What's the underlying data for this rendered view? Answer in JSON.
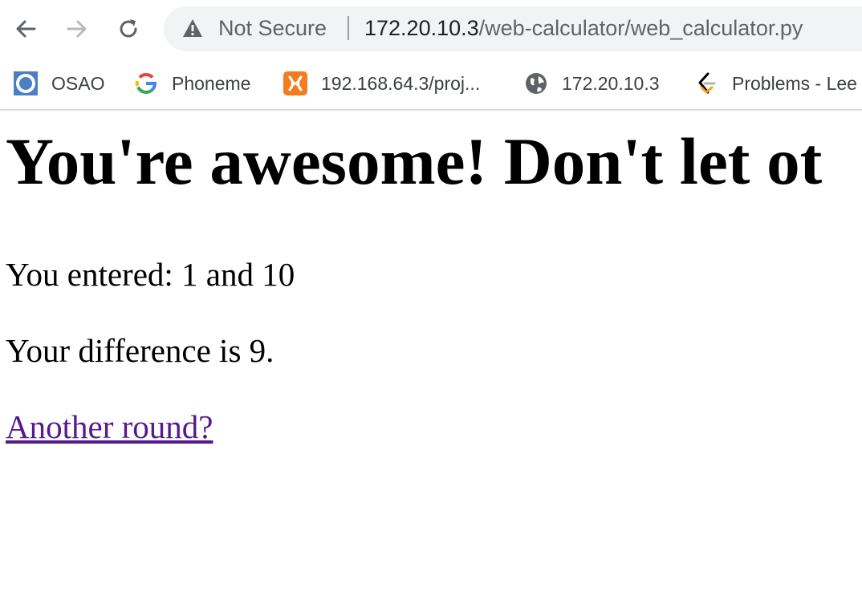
{
  "browser": {
    "omnibox": {
      "security_label": "Not Secure",
      "url_host": "172.20.10.3",
      "url_path": "/web-calculator/web_calculator.py"
    },
    "bookmarks": [
      {
        "label": "OSAO",
        "icon": "osao-icon"
      },
      {
        "label": "Phoneme",
        "icon": "google-icon"
      },
      {
        "label": "192.168.64.3/proj...",
        "icon": "xampp-icon"
      },
      {
        "label": "172.20.10.3",
        "icon": "globe-icon"
      },
      {
        "label": "Problems - Lee",
        "icon": "leetcode-icon"
      }
    ]
  },
  "page": {
    "headline": "You're awesome! Don't let ot",
    "entered": "You entered: 1 and 10",
    "result": "Your difference is 9.",
    "link": "Another round?"
  },
  "colors": {
    "visited_link": "#551a8b",
    "omnibox_bg": "#f1f3f4"
  }
}
